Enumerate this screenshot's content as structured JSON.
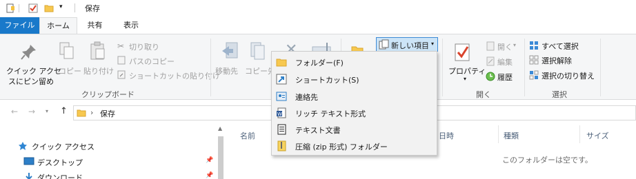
{
  "window": {
    "title": "保存"
  },
  "tabs": [
    {
      "label": "ファイル"
    },
    {
      "label": "ホーム"
    },
    {
      "label": "共有"
    },
    {
      "label": "表示"
    }
  ],
  "ribbon": {
    "clipboard": {
      "pin_line1": "クイック アクセ",
      "pin_line2": "スにピン留め",
      "copy": "コピー",
      "paste": "貼り付け",
      "cut": "切り取り",
      "copy_path": "パスのコピー",
      "paste_shortcut": "ショートカットの貼り付け",
      "group_label": "クリップボード"
    },
    "organize": {
      "move_to": "移動先",
      "copy_to": "コピー先"
    },
    "new": {
      "new_item": "新しい項目"
    },
    "open": {
      "properties": "プロパティ",
      "open": "開く",
      "edit": "編集",
      "history": "履歴",
      "group_label": "開く"
    },
    "select": {
      "select_all": "すべて選択",
      "select_none": "選択解除",
      "invert": "選択の切り替え",
      "group_label": "選択"
    }
  },
  "address": {
    "chevron": "›",
    "path": "保存"
  },
  "columns": [
    "名前",
    "日時",
    "種類",
    "サイズ"
  ],
  "nav_pane": [
    {
      "label": "クイック アクセス"
    },
    {
      "label": "デスクトップ"
    },
    {
      "label": "ダウンロード"
    }
  ],
  "empty_message": "このフォルダーは空です。",
  "new_item_menu": [
    {
      "label": "フォルダー(F)",
      "icon": "folder-icon"
    },
    {
      "label": "ショートカット(S)",
      "icon": "shortcut-icon"
    },
    {
      "label": "連絡先",
      "icon": "contact-icon"
    },
    {
      "label": "リッチ テキスト形式",
      "icon": "rtf-document-icon"
    },
    {
      "label": "テキスト文書",
      "icon": "text-document-icon"
    },
    {
      "label": "圧縮 (zip 形式) フォルダー",
      "icon": "zip-folder-icon"
    }
  ]
}
